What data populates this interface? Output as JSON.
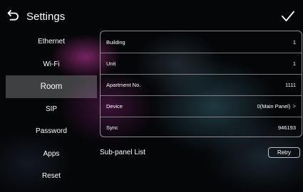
{
  "header": {
    "title": "Settings",
    "back_icon": "back-arrow-icon",
    "confirm_icon": "checkmark-icon"
  },
  "sidebar": {
    "items": [
      {
        "label": "Ethernet",
        "active": false
      },
      {
        "label": "Wi-Fi",
        "active": false
      },
      {
        "label": "Room",
        "active": true
      },
      {
        "label": "SIP",
        "active": false
      },
      {
        "label": "Password",
        "active": false
      },
      {
        "label": "Apps",
        "active": false
      },
      {
        "label": "Reset",
        "active": false
      }
    ]
  },
  "room": {
    "rows": [
      {
        "label": "Building",
        "value": "1"
      },
      {
        "label": "Unit",
        "value": "1"
      },
      {
        "label": "Apartment No.",
        "value": "1111"
      },
      {
        "label": "Device",
        "value": "0(Main Panel)",
        "chevron": ">"
      },
      {
        "label": "Sync",
        "value": "946193"
      }
    ],
    "subpanel_label": "Sub-panel List",
    "retry_label": "Retry"
  }
}
